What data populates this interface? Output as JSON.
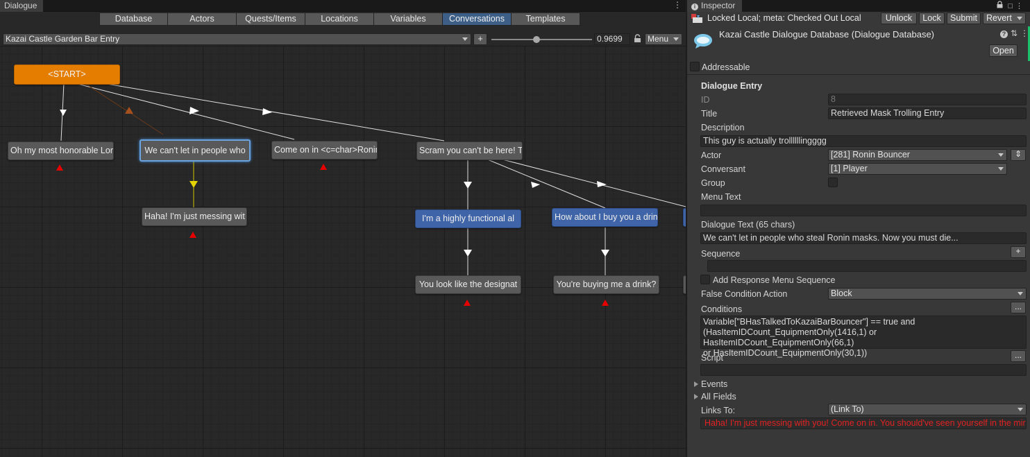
{
  "dialogue": {
    "tab_title": "Dialogue",
    "sections": [
      "Database",
      "Actors",
      "Quests/Items",
      "Locations",
      "Variables",
      "Conversations",
      "Templates"
    ],
    "active_section": "Conversations",
    "conversation": "Kazai Castle Garden Bar Entry",
    "add_label": "+",
    "zoom_value": "0.9699",
    "zoom_fraction": 0.45,
    "menu_label": "Menu",
    "nodes": {
      "start": "<START>",
      "n1": "Oh my most honorable Lord.",
      "n2": "We can't let in people who",
      "n3": "Come on in  <c=char>Ronin-",
      "n4": "Scram you can't be here! T",
      "n5": "Haha! I'm just messing wit",
      "n6": "I'm a highly functional al",
      "n7": "How about I buy you a drin",
      "n8": "You look like the designat",
      "n9": "You're buying me a drink?"
    }
  },
  "inspector": {
    "tab_title": "Inspector",
    "vcs_status": "Locked Local; meta: Checked Out Local",
    "vcs_buttons": {
      "unlock": "Unlock",
      "lock": "Lock",
      "submit": "Submit",
      "revert": "Revert"
    },
    "object_title": "Kazai Castle Dialogue Database (Dialogue Database)",
    "open_label": "Open",
    "addressable_label": "Addressable",
    "section_title": "Dialogue Entry",
    "fields": {
      "id_label": "ID",
      "id_value": "8",
      "title_label": "Title",
      "title_value": "Retrieved Mask Trolling Entry",
      "description_label": "Description",
      "description_value": "This guy is actually trollllllingggg",
      "actor_label": "Actor",
      "actor_value": "[281] Ronin Bouncer",
      "conversant_label": "Conversant",
      "conversant_value": "[1] Player",
      "group_label": "Group",
      "menu_text_label": "Menu Text",
      "menu_text_value": "",
      "dialogue_text_label": "Dialogue Text (65 chars)",
      "dialogue_text_value": "We can't let in people who steal Ronin masks. Now you must die...",
      "sequence_label": "Sequence",
      "sequence_plus": "+",
      "add_response_label": "Add Response Menu Sequence",
      "false_condition_label": "False Condition Action",
      "false_condition_value": "Block",
      "conditions_label": "Conditions",
      "conditions_line1": "Variable[\"BHasTalkedToKazaiBarBouncer\"] == true and",
      "conditions_line2": "(HasItemIDCount_EquipmentOnly(1416,1) or HasItemIDCount_EquipmentOnly(66,1)",
      "conditions_line3": "or HasItemIDCount_EquipmentOnly(30,1))",
      "script_label": "Script",
      "ellipsis": "...",
      "events_label": "Events",
      "all_fields_label": "All Fields",
      "links_to_label": "Links To:",
      "links_to_value": "(Link To)",
      "link_entry": "Haha! I'm just messing with you! Come on in. You should've seen yourself in the mirror..."
    }
  },
  "colors": {
    "start_node": "#e47d00",
    "npc_node": "#595959",
    "player_node": "#3f64a8",
    "selected_outline": "#6aa4e0",
    "link_red": "#e22222",
    "active_tab": "#3d5f87"
  },
  "icons": [
    "kebab-icon",
    "lock-icon",
    "info-icon",
    "vcs-icon",
    "dialogue-db-icon",
    "help-icon",
    "settings-icon",
    "more-icon",
    "caret-down-icon",
    "red-triangle-icon",
    "foldout-arrow-icon"
  ]
}
